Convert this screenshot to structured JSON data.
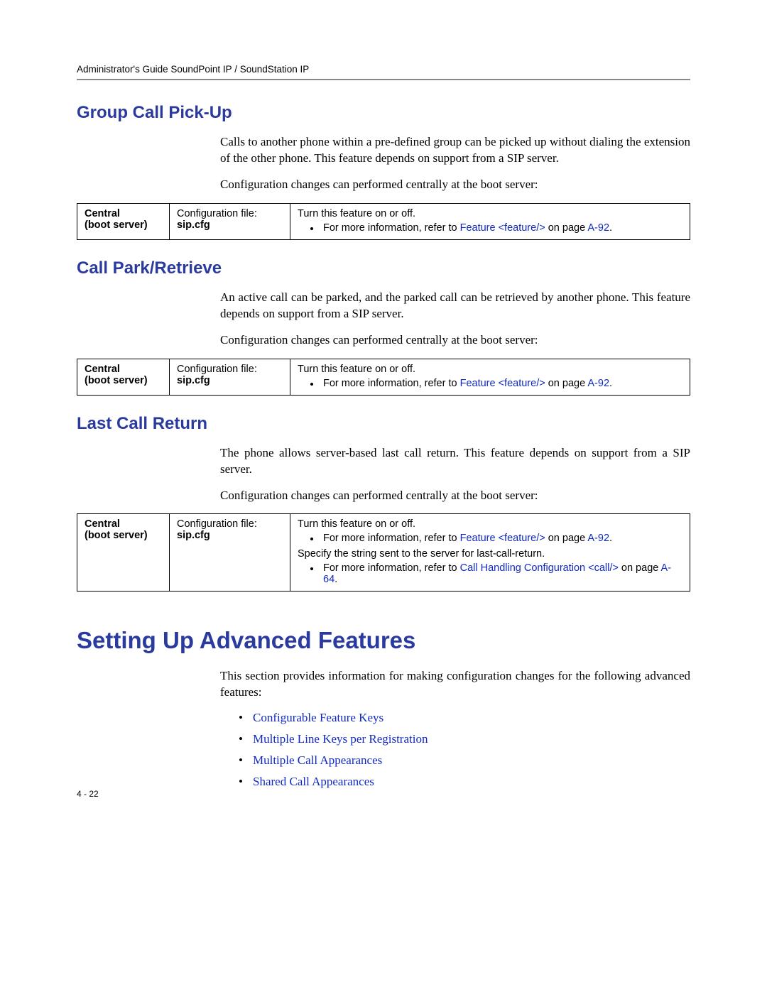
{
  "header": "Administrator's Guide SoundPoint IP / SoundStation IP",
  "s1": {
    "heading": "Group Call Pick-Up",
    "para1": "Calls to another phone within a pre-defined group can be picked up without dialing the extension of the other phone. This feature depends on support from a SIP server.",
    "para2": "Configuration changes can performed centrally at the boot server:",
    "table": {
      "c1a": "Central",
      "c1b": "(boot server)",
      "c2a": "Configuration file:",
      "c2b": "sip.cfg",
      "c3line1": "Turn this feature on or off.",
      "c3bullet_pre": "For more information, refer to ",
      "c3bullet_link": "Feature <feature/>",
      "c3bullet_mid": " on page ",
      "c3bullet_page": "A-92",
      "c3bullet_post": "."
    }
  },
  "s2": {
    "heading": "Call Park/Retrieve",
    "para1": "An active call can be parked, and the parked call can be retrieved by another phone. This feature depends on support from a SIP server.",
    "para2": "Configuration changes can performed centrally at the boot server:",
    "table": {
      "c1a": "Central",
      "c1b": "(boot server)",
      "c2a": "Configuration file:",
      "c2b": "sip.cfg",
      "c3line1": "Turn this feature on or off.",
      "c3bullet_pre": "For more information, refer to ",
      "c3bullet_link": "Feature <feature/>",
      "c3bullet_mid": " on page ",
      "c3bullet_page": "A-92",
      "c3bullet_post": "."
    }
  },
  "s3": {
    "heading": "Last Call Return",
    "para1": "The phone allows server-based last call return. This feature depends on support from a SIP server.",
    "para2": "Configuration changes can performed centrally at the boot server:",
    "table": {
      "c1a": "Central",
      "c1b": "(boot server)",
      "c2a": "Configuration file:",
      "c2b": "sip.cfg",
      "c3line1": "Turn this feature on or off.",
      "c3bullet1_pre": "For more information, refer to ",
      "c3bullet1_link": "Feature <feature/>",
      "c3bullet1_mid": " on page ",
      "c3bullet1_page": "A-92",
      "c3bullet1_post": ".",
      "c3line2": "Specify the string sent to the server for last-call-return.",
      "c3bullet2_pre": "For more information, refer to ",
      "c3bullet2_link": "Call Handling Configuration <call/>",
      "c3bullet2_mid": " on page ",
      "c3bullet2_page": "A-64",
      "c3bullet2_post": "."
    }
  },
  "main": {
    "heading": "Setting Up Advanced Features",
    "para": "This section provides information for making configuration changes for the following advanced features:",
    "items": [
      "Configurable Feature Keys",
      "Multiple Line Keys per Registration",
      "Multiple Call Appearances",
      "Shared Call Appearances"
    ]
  },
  "page_number": "4 - 22"
}
